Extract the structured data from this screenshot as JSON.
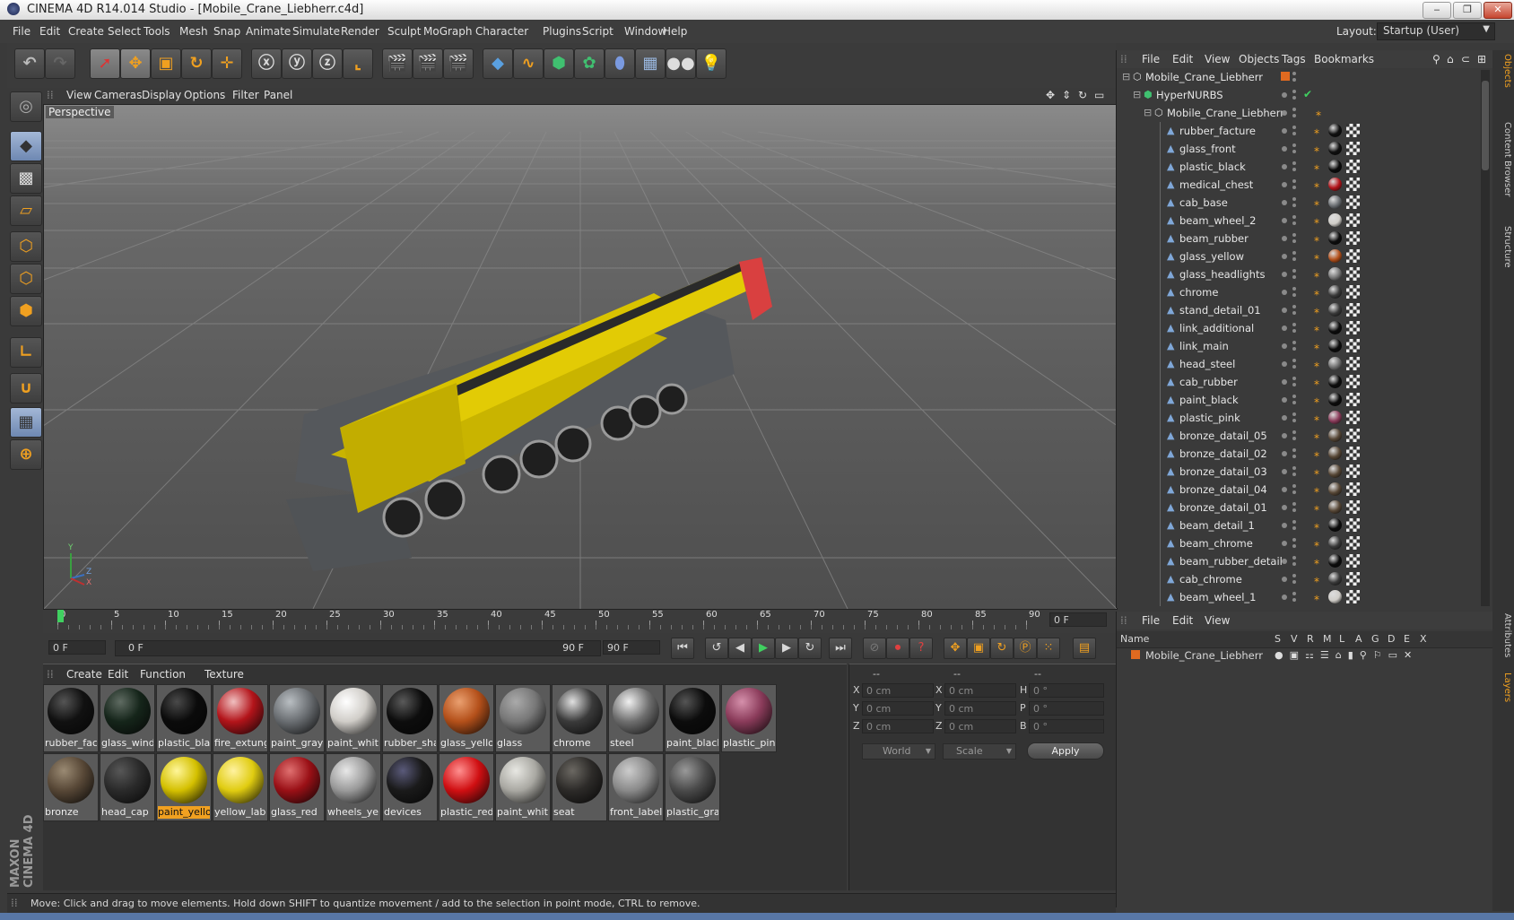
{
  "window": {
    "title": "CINEMA 4D R14.014 Studio - [Mobile_Crane_Liebherr.c4d]",
    "min_label": "‒",
    "max_label": "❐",
    "close_label": "✕"
  },
  "menubar": {
    "items": [
      "File",
      "Edit",
      "Create",
      "Select",
      "Tools",
      "Mesh",
      "Snap",
      "Animate",
      "Simulate",
      "Render",
      "Sculpt",
      "MoGraph",
      "Character",
      "Plugins",
      "Script",
      "Window",
      "Help"
    ],
    "layout_label": "Layout:",
    "layout_value": "Startup (User)"
  },
  "viewport": {
    "menu": [
      "View",
      "Cameras",
      "Display",
      "Options",
      "Filter",
      "Panel"
    ],
    "label": "Perspective",
    "axis": {
      "y": "Y",
      "z": "Z",
      "x": "X"
    }
  },
  "timeline": {
    "ticks": [
      "0",
      "5",
      "10",
      "15",
      "20",
      "25",
      "30",
      "35",
      "40",
      "45",
      "50",
      "55",
      "60",
      "65",
      "70",
      "75",
      "80",
      "85",
      "90"
    ],
    "current_frame": "0 F",
    "start_field": "0 F",
    "slider_left": "0 F",
    "slider_right": "90 F",
    "end_field": "90 F"
  },
  "material_manager": {
    "menu": [
      "Create",
      "Edit",
      "Function",
      "Texture"
    ],
    "materials": [
      {
        "label": "rubber_fac",
        "color": "#111111",
        "hl": "#555555"
      },
      {
        "label": "glass_wind",
        "color": "#15251a",
        "hl": "#5f6b62"
      },
      {
        "label": "plastic_bla",
        "color": "#0b0b0b",
        "hl": "#4a4a4a"
      },
      {
        "label": "fire_extung",
        "color": "#b3141a",
        "hl": "#f0c0c0"
      },
      {
        "label": "paint_gray",
        "color": "#6a6e72",
        "hl": "#b9bec2"
      },
      {
        "label": "paint_whit",
        "color": "#d0cdc8",
        "hl": "#ffffff"
      },
      {
        "label": "rubber_sha",
        "color": "#0d0d0d",
        "hl": "#5a5a5a"
      },
      {
        "label": "glass_yello",
        "color": "#b4501a",
        "hl": "#eaa070"
      },
      {
        "label": "glass",
        "color": "#777777",
        "hl": "#aaaaaa"
      },
      {
        "label": "chrome",
        "color": "#3a3a3a",
        "hl": "#e0e0e0"
      },
      {
        "label": "steel",
        "color": "#6f6f6f",
        "hl": "#f0f0f0"
      },
      {
        "label": "paint_black",
        "color": "#0c0c0c",
        "hl": "#555555"
      },
      {
        "label": "plastic_pin",
        "color": "#8a3b5a",
        "hl": "#d590ab"
      },
      {
        "label": "bronze",
        "color": "#574736",
        "hl": "#9a8a73"
      },
      {
        "label": "head_cap",
        "color": "#2a2a2a",
        "hl": "#575757"
      },
      {
        "label": "paint_yello",
        "color": "#d4c000",
        "hl": "#fff69a"
      },
      {
        "label": "yellow_labe",
        "color": "#e0cc10",
        "hl": "#fff2a0"
      },
      {
        "label": "glass_red",
        "color": "#9a1016",
        "hl": "#e07070"
      },
      {
        "label": "wheels_yel",
        "color": "#9a9a9a",
        "hl": "#e8e8e8"
      },
      {
        "label": "devices",
        "color": "#1a1a1a",
        "hl": "#5a5a7a"
      },
      {
        "label": "plastic_red",
        "color": "#d00f12",
        "hl": "#ff9090"
      },
      {
        "label": "paint_whit",
        "color": "#a9a8a2",
        "hl": "#e8e8e3"
      },
      {
        "label": "seat",
        "color": "#2c2a28",
        "hl": "#6b6862"
      },
      {
        "label": "front_label",
        "color": "#8a8a8a",
        "hl": "#cccccc"
      },
      {
        "label": "plastic_gra",
        "color": "#4a4a4a",
        "hl": "#999999"
      }
    ],
    "selected_index": 15
  },
  "coordinates": {
    "header": [
      "--",
      "--",
      "--"
    ],
    "rows": [
      {
        "a": "X",
        "av": "0 cm",
        "b": "X",
        "bv": "0 cm",
        "c": "H",
        "cv": "0 °"
      },
      {
        "a": "Y",
        "av": "0 cm",
        "b": "Y",
        "bv": "0 cm",
        "c": "P",
        "cv": "0 °"
      },
      {
        "a": "Z",
        "av": "0 cm",
        "b": "Z",
        "bv": "0 cm",
        "c": "B",
        "cv": "0 °"
      }
    ],
    "mode": "World",
    "scale": "Scale",
    "apply": "Apply"
  },
  "object_manager": {
    "menu": [
      "File",
      "Edit",
      "View",
      "Objects",
      "Tags",
      "Bookmarks"
    ],
    "top": [
      {
        "name": "Mobile_Crane_Liebherr",
        "indent": 0
      },
      {
        "name": "HyperNURBS",
        "indent": 1
      },
      {
        "name": "Mobile_Crane_Liebherr",
        "indent": 2
      }
    ],
    "objects": [
      {
        "name": "rubber_facture",
        "mat": "#111111"
      },
      {
        "name": "glass_front",
        "mat": "#101010"
      },
      {
        "name": "plastic_black",
        "mat": "#0b0b0b"
      },
      {
        "name": "medical_chest",
        "mat": "#b3141a"
      },
      {
        "name": "cab_base",
        "mat": "#6a6e72"
      },
      {
        "name": "beam_wheel_2",
        "mat": "#d0cdc8"
      },
      {
        "name": "beam_rubber",
        "mat": "#0d0d0d"
      },
      {
        "name": "glass_yellow",
        "mat": "#b4501a"
      },
      {
        "name": "glass_headlights",
        "mat": "#777777"
      },
      {
        "name": "chrome",
        "mat": "#3a3a3a"
      },
      {
        "name": "stand_detail_01",
        "mat": "#3a3a3a"
      },
      {
        "name": "link_additional",
        "mat": "#0c0c0c"
      },
      {
        "name": "link_main",
        "mat": "#0c0c0c"
      },
      {
        "name": "head_steel",
        "mat": "#6f6f6f"
      },
      {
        "name": "cab_rubber",
        "mat": "#0d0d0d"
      },
      {
        "name": "paint_black",
        "mat": "#0c0c0c"
      },
      {
        "name": "plastic_pink",
        "mat": "#8a3b5a"
      },
      {
        "name": "bronze_datail_05",
        "mat": "#574736"
      },
      {
        "name": "bronze_datail_02",
        "mat": "#574736"
      },
      {
        "name": "bronze_datail_03",
        "mat": "#574736"
      },
      {
        "name": "bronze_datail_04",
        "mat": "#574736"
      },
      {
        "name": "bronze_datail_01",
        "mat": "#574736"
      },
      {
        "name": "beam_detail_1",
        "mat": "#0c0c0c"
      },
      {
        "name": "beam_chrome",
        "mat": "#3a3a3a"
      },
      {
        "name": "beam_rubber_detail",
        "mat": "#0d0d0d"
      },
      {
        "name": "cab_chrome",
        "mat": "#3a3a3a"
      },
      {
        "name": "beam_wheel_1",
        "mat": "#d0cdc8"
      }
    ]
  },
  "layer_manager": {
    "menu": [
      "File",
      "Edit",
      "View"
    ],
    "columns": [
      "Name",
      "S",
      "V",
      "R",
      "M",
      "L",
      "A",
      "G",
      "D",
      "E",
      "X"
    ],
    "layer_name": "Mobile_Crane_Liebherr"
  },
  "side_tabs": [
    "Objects",
    "Content Browser",
    "Structure",
    "Attributes",
    "Layers"
  ],
  "status": "Move: Click and drag to move elements. Hold down SHIFT to quantize movement / add to the selection in point mode, CTRL to remove.",
  "branding": "MAXON CINEMA 4D",
  "colors": {
    "accent": "#f0a020",
    "timeline_marker": "#40d060",
    "viewport_bg": "#666666"
  }
}
